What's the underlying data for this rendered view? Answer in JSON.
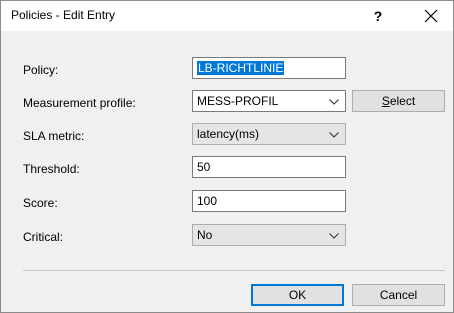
{
  "window": {
    "title": "Policies - Edit Entry",
    "help_label": "?",
    "close_icon": "close-icon"
  },
  "form": {
    "policy": {
      "label": "Policy:",
      "value": "LB-RICHTLINIE"
    },
    "measurement_profile": {
      "label": "Measurement profile:",
      "value": "MESS-PROFIL",
      "button_label": "Select"
    },
    "sla_metric": {
      "label": "SLA metric:",
      "value": "latency(ms)"
    },
    "threshold": {
      "label": "Threshold:",
      "value": "50"
    },
    "score": {
      "label": "Score:",
      "value": "100"
    },
    "critical": {
      "label": "Critical:",
      "value": "No"
    }
  },
  "footer": {
    "ok_label": "OK",
    "cancel_label": "Cancel"
  },
  "colors": {
    "accent": "#0078d7",
    "dialog_bg": "#f0f0f0",
    "button_bg": "#e1e1e1"
  }
}
